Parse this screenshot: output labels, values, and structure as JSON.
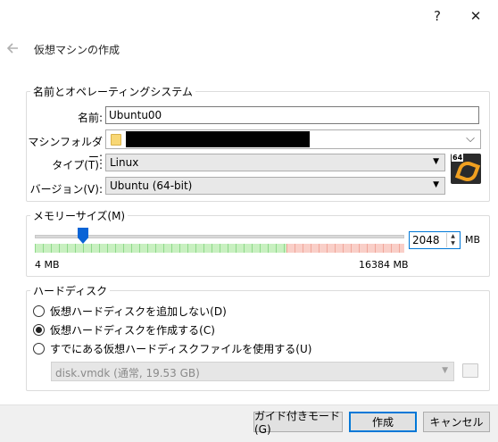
{
  "titlebar": {
    "help_label": "?",
    "close_label": "✕"
  },
  "wizard": {
    "title": "仮想マシンの作成",
    "back_icon": "back-arrow-icon"
  },
  "name_group": {
    "title": "名前とオペレーティングシステム",
    "name_label": "名前:",
    "name_value": "Ubuntu00",
    "folder_label": "マシンフォルダー:",
    "type_label": "タイプ(T):",
    "type_value": "Linux",
    "version_label": "バージョン(V):",
    "version_value": "Ubuntu (64-bit)",
    "os_badge_text": "64"
  },
  "memory_group": {
    "title": "メモリーサイズ(M)",
    "value": "2048",
    "unit": "MB",
    "min_label": "4 MB",
    "max_label": "16384 MB",
    "slider_fraction": 0.125
  },
  "disk_group": {
    "title": "ハードディスク",
    "options": [
      {
        "label": "仮想ハードディスクを追加しない(D)",
        "selected": false
      },
      {
        "label": "仮想ハードディスクを作成する(C)",
        "selected": true
      },
      {
        "label": "すでにある仮想ハードディスクファイルを使用する(U)",
        "selected": false
      }
    ],
    "existing_disk": "disk.vmdk (通常, 19.53 GB)"
  },
  "buttons": {
    "guided_label": "ガイド付きモード(G)",
    "create_label": "作成",
    "cancel_label": "キャンセル"
  },
  "colors": {
    "accent": "#0078d7",
    "slider_thumb": "#0a64d6"
  }
}
